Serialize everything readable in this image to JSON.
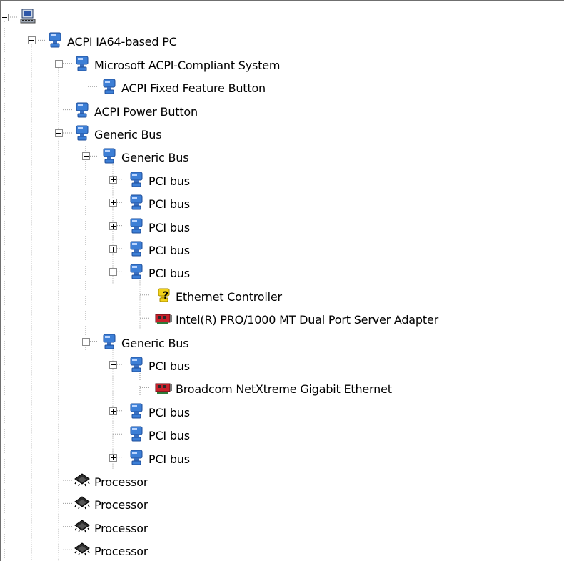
{
  "nodes": [
    {
      "id": "root",
      "label": "",
      "icon": "computer-icon",
      "expander": "minus"
    },
    {
      "id": "acpi-pc",
      "label": "ACPI IA64-based PC",
      "icon": "device-node-icon",
      "expander": "minus"
    },
    {
      "id": "ms-acpi",
      "label": "Microsoft ACPI-Compliant System",
      "icon": "device-node-icon",
      "expander": "minus"
    },
    {
      "id": "fixed-btn",
      "label": "ACPI Fixed Feature Button",
      "icon": "device-node-icon",
      "expander": "none"
    },
    {
      "id": "power-btn",
      "label": "ACPI Power Button",
      "icon": "device-node-icon",
      "expander": "none"
    },
    {
      "id": "gbus-1",
      "label": "Generic Bus",
      "icon": "device-node-icon",
      "expander": "minus"
    },
    {
      "id": "gbus-2",
      "label": "Generic Bus",
      "icon": "device-node-icon",
      "expander": "minus"
    },
    {
      "id": "pci-1",
      "label": "PCI bus",
      "icon": "device-node-icon",
      "expander": "plus"
    },
    {
      "id": "pci-2",
      "label": "PCI bus",
      "icon": "device-node-icon",
      "expander": "plus"
    },
    {
      "id": "pci-3",
      "label": "PCI bus",
      "icon": "device-node-icon",
      "expander": "plus"
    },
    {
      "id": "pci-4",
      "label": "PCI bus",
      "icon": "device-node-icon",
      "expander": "plus"
    },
    {
      "id": "pci-5",
      "label": "PCI bus",
      "icon": "device-node-icon",
      "expander": "minus"
    },
    {
      "id": "eth-ctrl",
      "label": "Ethernet Controller",
      "icon": "unknown-device-warning-icon",
      "expander": "none"
    },
    {
      "id": "intel-nic",
      "label": "Intel(R) PRO/1000 MT Dual Port Server Adapter",
      "icon": "network-card-icon",
      "expander": "none"
    },
    {
      "id": "gbus-3",
      "label": "Generic Bus",
      "icon": "device-node-icon",
      "expander": "minus"
    },
    {
      "id": "pci-6",
      "label": "PCI bus",
      "icon": "device-node-icon",
      "expander": "minus"
    },
    {
      "id": "bcm-nic",
      "label": "Broadcom NetXtreme Gigabit Ethernet",
      "icon": "network-card-icon",
      "expander": "none"
    },
    {
      "id": "pci-7",
      "label": "PCI bus",
      "icon": "device-node-icon",
      "expander": "plus"
    },
    {
      "id": "pci-8",
      "label": "PCI bus",
      "icon": "device-node-icon",
      "expander": "none"
    },
    {
      "id": "pci-9",
      "label": "PCI bus",
      "icon": "device-node-icon",
      "expander": "plus"
    },
    {
      "id": "cpu-1",
      "label": "Processor",
      "icon": "processor-chip-icon",
      "expander": "none"
    },
    {
      "id": "cpu-2",
      "label": "Processor",
      "icon": "processor-chip-icon",
      "expander": "none"
    },
    {
      "id": "cpu-3",
      "label": "Processor",
      "icon": "processor-chip-icon",
      "expander": "none"
    },
    {
      "id": "cpu-4",
      "label": "Processor",
      "icon": "processor-chip-icon",
      "expander": "none"
    }
  ],
  "colors": {
    "device_node_blue": "#3d7fd6",
    "warning_yellow": "#f2d21a",
    "network_card_red": "#c8202a",
    "processor_black": "#2a2a2a",
    "tree_line": "#9a9a9a"
  }
}
